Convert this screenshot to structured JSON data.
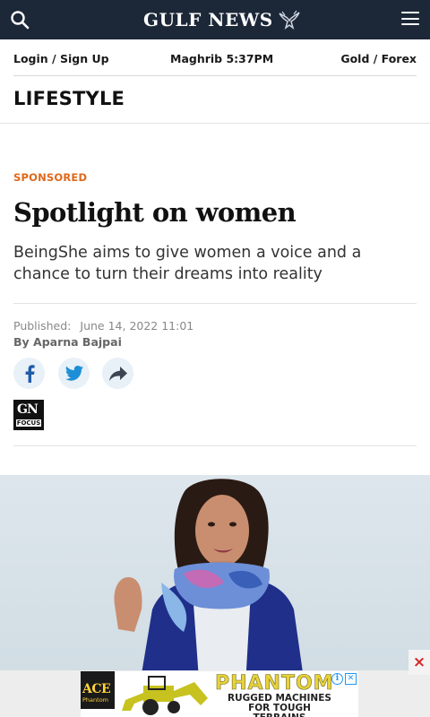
{
  "header": {
    "logo_text": "GULF NEWS",
    "search_icon": "search-icon",
    "menu_icon": "hamburger-menu-icon",
    "background": "#1c2738"
  },
  "utility_bar": {
    "login": "Login / Sign Up",
    "prayer_time": "Maghrib 5:37PM",
    "gold_forex": "Gold / Forex"
  },
  "section": {
    "title": "LIFESTYLE"
  },
  "article": {
    "kicker": "SPONSORED",
    "kicker_color": "#e0681a",
    "headline": "Spotlight on women",
    "standfirst": "BeingShe aims to give women a voice and a chance to turn their dreams into reality",
    "published_label": "Published:",
    "published_date": "June 14, 2022 11:01",
    "byline": "By Aparna Bajpai",
    "share": {
      "facebook_icon": "facebook-icon",
      "twitter_icon": "twitter-icon",
      "more_icon": "share-forward-icon"
    },
    "badge": {
      "gn": "GN",
      "focus": "FOCUS"
    }
  },
  "ad": {
    "close": "×",
    "ace_brand": "ACE",
    "ace_sub": "Phantom",
    "brand": "PHANTOM",
    "tagline": "RUGGED MACHINES FOR TOUGH TERRAINS",
    "info": "i",
    "x": "✕"
  }
}
